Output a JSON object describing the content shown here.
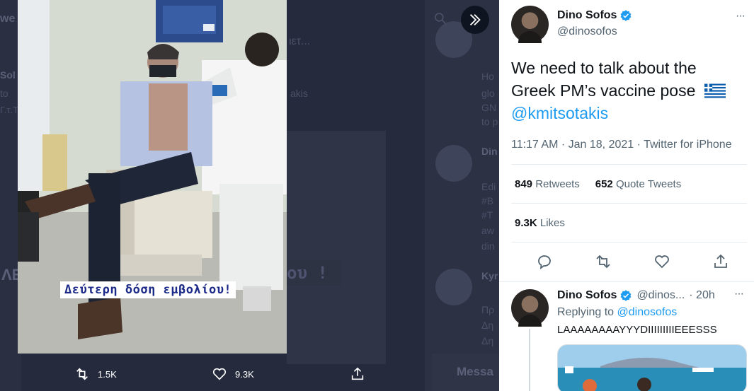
{
  "tweet": {
    "author_name": "Dino Sofos",
    "author_handle": "@dinosofos",
    "text_line1": "We need to talk about the",
    "text_line2": "Greek PM’s vaccine pose",
    "mention": "@kmitsotakis",
    "timestamp": "11:17 AM · Jan 18, 2021 · Twitter for iPhone",
    "retweets_count": "849",
    "retweets_label": "Retweets",
    "quote_count": "652",
    "quote_label": "Quote Tweets",
    "likes_count": "9.3K",
    "likes_label": "Likes",
    "more_label": "···"
  },
  "reply": {
    "author_name": "Dino Sofos",
    "author_handle": "@dinos...",
    "time": "· 20h",
    "replying_prefix": "Replying to",
    "replying_to": "@dinosofos",
    "text": "LAAAAAAAAYYYDIIIIIIIIIEEESSS",
    "more_label": "···"
  },
  "media": {
    "caption": "Δεύτερη δόση εμβολίου!",
    "retweets": "1.5K",
    "likes": "9.3K",
    "expand_icon": "double-chevron-right-icon"
  },
  "background": {
    "sidebar_snippets": [
      "we",
      "Sol",
      "to",
      "Γ.τ.Τ..."
    ],
    "timeline_snippets": [
      "Ho",
      "glo",
      "GN",
      "to p",
      "Din",
      "Edi",
      "#B",
      "#T",
      "aw",
      "din",
      "Kyr",
      "Πρ",
      "Δη",
      "Δη"
    ],
    "mid_snippets": [
      "ιετ...",
      "akis"
    ],
    "messages_label": "Messa",
    "banner_fragment": "ου !",
    "side_fragment": "ΛE"
  },
  "colors": {
    "accent": "#1d9bf0",
    "overlay": "#252a3c",
    "caption_text": "#1b2a88"
  }
}
